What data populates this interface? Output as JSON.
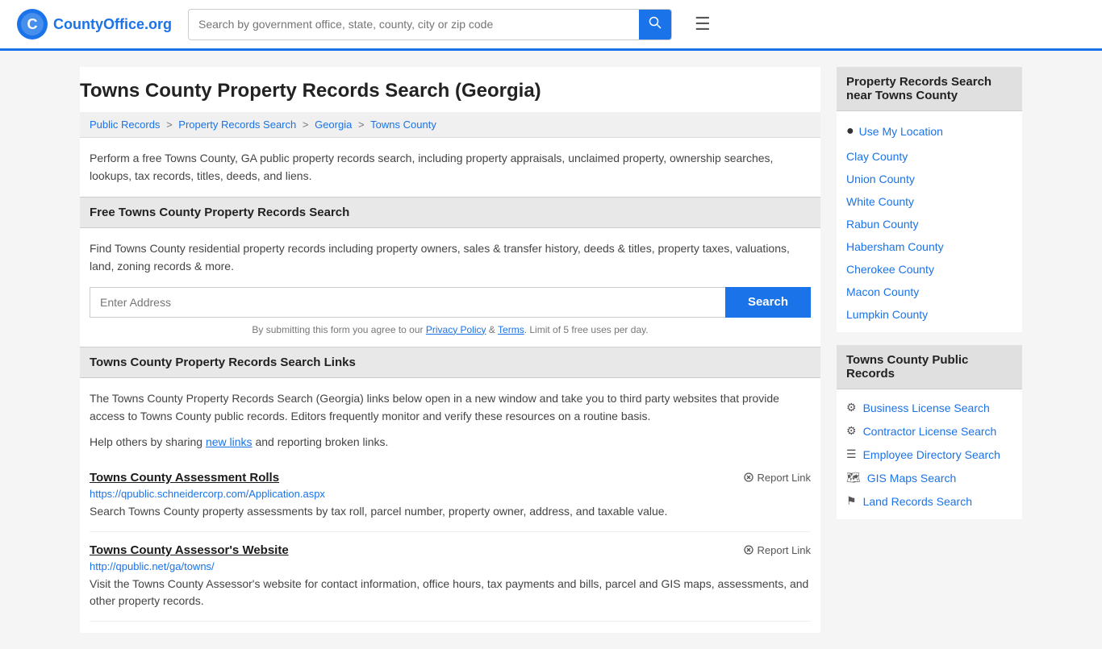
{
  "header": {
    "logo_text": "CountyOffice",
    "logo_suffix": ".org",
    "search_placeholder": "Search by government office, state, county, city or zip code",
    "search_button_label": "Search"
  },
  "page": {
    "title": "Towns County Property Records Search (Georgia)",
    "breadcrumb": [
      {
        "label": "Public Records",
        "href": "#"
      },
      {
        "label": "Property Records Search",
        "href": "#"
      },
      {
        "label": "Georgia",
        "href": "#"
      },
      {
        "label": "Towns County",
        "href": "#"
      }
    ],
    "description": "Perform a free Towns County, GA public property records search, including property appraisals, unclaimed property, ownership searches, lookups, tax records, titles, deeds, and liens.",
    "free_search_header": "Free Towns County Property Records Search",
    "free_search_desc": "Find Towns County residential property records including property owners, sales & transfer history, deeds & titles, property taxes, valuations, land, zoning records & more.",
    "address_placeholder": "Enter Address",
    "search_button": "Search",
    "disclaimer": "By submitting this form you agree to our",
    "privacy_label": "Privacy Policy",
    "terms_label": "Terms",
    "limit_text": "Limit of 5 free uses per day.",
    "links_header": "Towns County Property Records Search Links",
    "links_desc": "The Towns County Property Records Search (Georgia) links below open in a new window and take you to third party websites that provide access to Towns County public records. Editors frequently monitor and verify these resources on a routine basis.",
    "help_text_1": "Help others by sharing",
    "help_text_link": "new links",
    "help_text_2": "and reporting broken links.",
    "record_links": [
      {
        "title": "Towns County Assessment Rolls",
        "url": "https://qpublic.schneidercorp.com/Application.aspx",
        "desc": "Search Towns County property assessments by tax roll, parcel number, property owner, address, and taxable value.",
        "report": "Report Link"
      },
      {
        "title": "Towns County Assessor's Website",
        "url": "http://qpublic.net/ga/towns/",
        "desc": "Visit the Towns County Assessor's website for contact information, office hours, tax payments and bills, parcel and GIS maps, assessments, and other property records.",
        "report": "Report Link"
      }
    ]
  },
  "sidebar": {
    "nearby_header": "Property Records Search near Towns County",
    "use_location": "Use My Location",
    "nearby_counties": [
      "Clay County",
      "Union County",
      "White County",
      "Rabun County",
      "Habersham County",
      "Cherokee County",
      "Macon County",
      "Lumpkin County"
    ],
    "public_records_header": "Towns County Public Records",
    "public_records_links": [
      {
        "label": "Business License Search",
        "icon": "⚙"
      },
      {
        "label": "Contractor License Search",
        "icon": "⚙"
      },
      {
        "label": "Employee Directory Search",
        "icon": "☰"
      },
      {
        "label": "GIS Maps Search",
        "icon": "🗺"
      },
      {
        "label": "Land Records Search",
        "icon": "⚑"
      }
    ]
  }
}
